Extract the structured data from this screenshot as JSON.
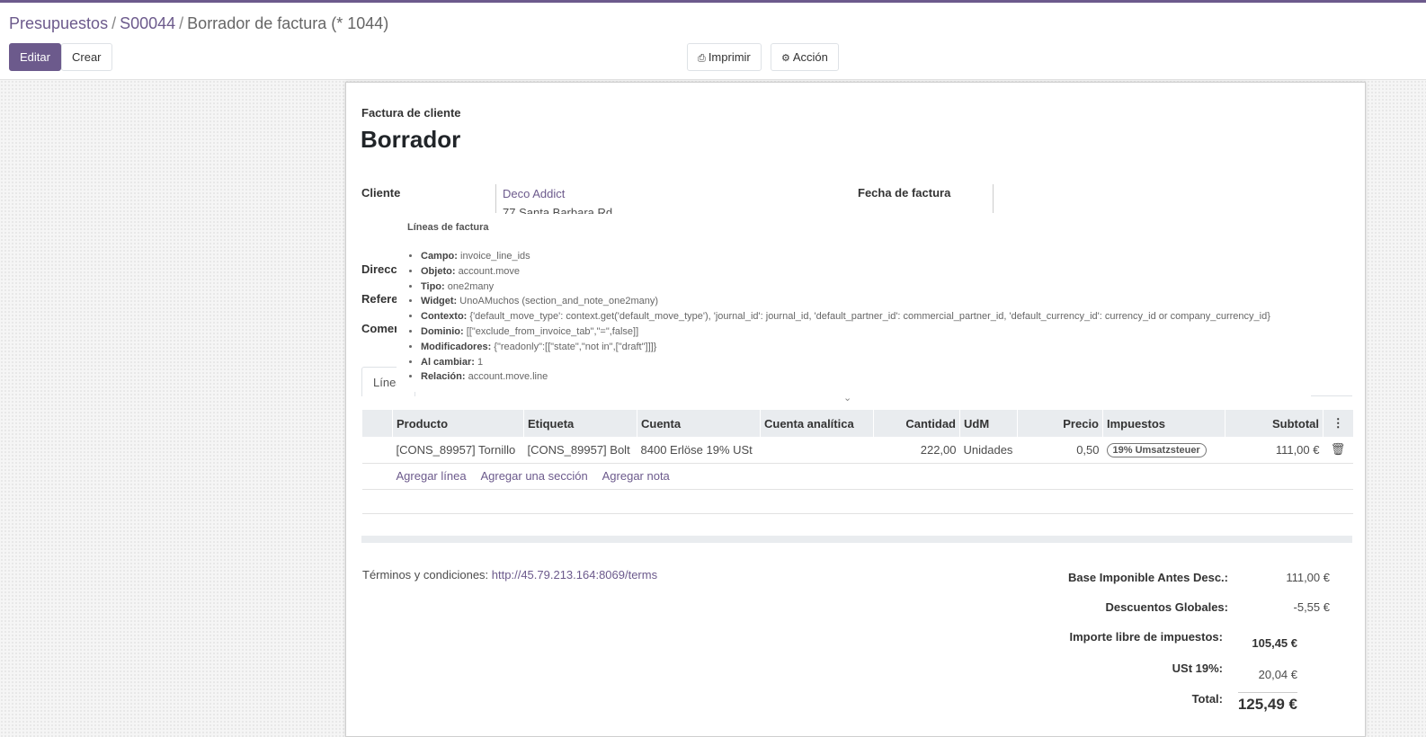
{
  "breadcrumb": {
    "items": [
      "Presupuestos",
      "S00044"
    ],
    "current": "Borrador de factura (* 1044)"
  },
  "toolbar": {
    "edit_label": "Editar",
    "create_label": "Crear",
    "print_label": "Imprimir",
    "action_label": "Acción"
  },
  "sheet": {
    "doc_type": "Factura de cliente",
    "state": "Borrador",
    "customer_label": "Cliente",
    "customer_name": "Deco Addict",
    "customer_address": "77 Santa Barbara Rd",
    "invoice_date_label": "Fecha de factura",
    "address_label_partial": "Direcci",
    "reference_label_partial": "Referer",
    "commercial_label_partial": "Comer",
    "tab_label_partial": "Línea"
  },
  "tooltip": {
    "title": "Líneas de factura",
    "items": [
      {
        "key": "Campo:",
        "value": "invoice_line_ids"
      },
      {
        "key": "Objeto:",
        "value": "account.move"
      },
      {
        "key": "Tipo:",
        "value": "one2many"
      },
      {
        "key": "Widget:",
        "value": "UnoAMuchos (section_and_note_one2many)"
      },
      {
        "key": "Contexto:",
        "value": "{'default_move_type': context.get('default_move_type'), 'journal_id': journal_id, 'default_partner_id': commercial_partner_id, 'default_currency_id': currency_id or company_currency_id}"
      },
      {
        "key": "Dominio:",
        "value": "[[\"exclude_from_invoice_tab\",\"=\",false]]"
      },
      {
        "key": "Modificadores:",
        "value": "{\"readonly\":[[\"state\",\"not in\",[\"draft\"]]]}"
      },
      {
        "key": "Al cambiar:",
        "value": "1"
      },
      {
        "key": "Relación:",
        "value": "account.move.line"
      }
    ]
  },
  "table": {
    "headers": [
      "Producto",
      "Etiqueta",
      "Cuenta",
      "Cuenta analítica",
      "Cantidad",
      "UdM",
      "Precio",
      "Impuestos",
      "Subtotal"
    ],
    "rows": [
      {
        "product": "[CONS_89957] Tornillo",
        "label": "[CONS_89957] Bolt",
        "account": "8400 Erlöse 19% USt",
        "analytic": "",
        "quantity": "222,00",
        "uom": "Unidades",
        "price": "0,50",
        "tax": "19% Umsatzsteuer",
        "subtotal": "111,00 €"
      }
    ],
    "add_line": "Agregar línea",
    "add_section": "Agregar una sección",
    "add_note": "Agregar nota"
  },
  "terms": {
    "label": "Términos y condiciones:",
    "url": "http://45.79.213.164:8069/terms"
  },
  "totals": {
    "base_label": "Base Imponible Antes Desc.:",
    "base_value": "111,00 €",
    "discount_label": "Descuentos Globales:",
    "discount_value": "-5,55 €",
    "untaxed_label": "Importe libre de impuestos:",
    "untaxed_value": "105,45 €",
    "tax_label": "USt 19%:",
    "tax_value": "20,04 €",
    "total_label": "Total:",
    "total_value": "125,49 €"
  },
  "colors": {
    "accent": "#6c5a8c"
  }
}
